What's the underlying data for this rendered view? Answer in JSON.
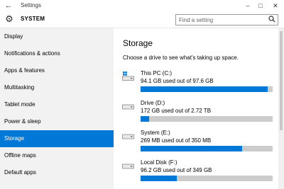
{
  "window": {
    "title": "Settings",
    "controls": [
      "–",
      "□",
      "✕"
    ]
  },
  "header": {
    "section": "SYSTEM",
    "search_placeholder": "Find a setting"
  },
  "sidebar": {
    "items": [
      {
        "label": "Display"
      },
      {
        "label": "Notifications & actions"
      },
      {
        "label": "Apps & features"
      },
      {
        "label": "Multitasking"
      },
      {
        "label": "Tablet mode"
      },
      {
        "label": "Power & sleep"
      },
      {
        "label": "Storage",
        "selected": true
      },
      {
        "label": "Offline maps"
      },
      {
        "label": "Default apps"
      }
    ]
  },
  "main": {
    "title": "Storage",
    "subtitle": "Choose a drive to see what's taking up space.",
    "drives": [
      {
        "name": "This PC (C:)",
        "usage": "94.1 GB used out of 97.6 GB",
        "fraction": 0.964,
        "icon": "system-drive-icon"
      },
      {
        "name": "Drive (D:)",
        "usage": "172 GB used out of 2.72 TB",
        "fraction": 0.062,
        "icon": "drive-icon"
      },
      {
        "name": "System (E:)",
        "usage": "269 MB used out of 350 MB",
        "fraction": 0.77,
        "icon": "drive-icon"
      },
      {
        "name": "Local Disk (F:)",
        "usage": "96.2 GB used out of 349 GB",
        "fraction": 0.276,
        "icon": "drive-icon"
      }
    ]
  },
  "colors": {
    "accent": "#0078d7",
    "sidebar_bg": "#f2f2f2",
    "bar_track": "#cccccc"
  }
}
